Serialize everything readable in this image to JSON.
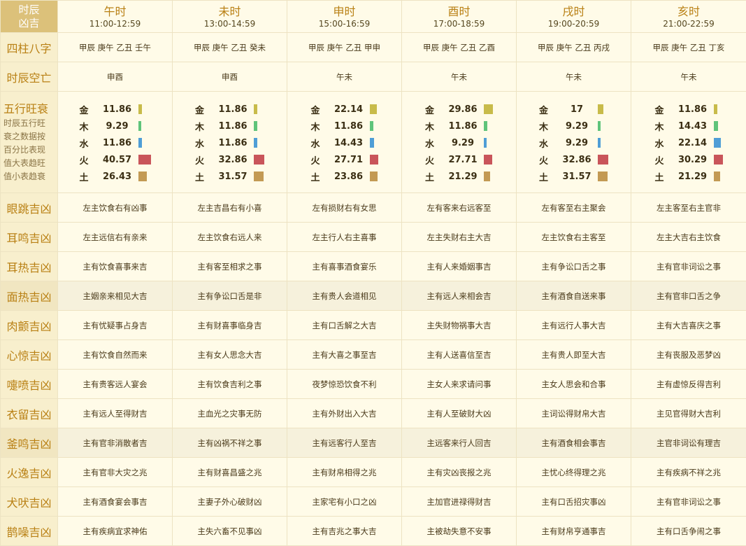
{
  "corner": {
    "line1": "时辰",
    "line2": "凶吉"
  },
  "columns": [
    {
      "name": "午时",
      "time": "11:00-12:59"
    },
    {
      "name": "未时",
      "time": "13:00-14:59"
    },
    {
      "name": "申时",
      "time": "15:00-16:59"
    },
    {
      "name": "酉时",
      "time": "17:00-18:59"
    },
    {
      "name": "戌时",
      "time": "19:00-20:59"
    },
    {
      "name": "亥时",
      "time": "21:00-22:59"
    }
  ],
  "bazi": {
    "label": "四柱八字",
    "values": [
      "甲辰 庚午 乙丑 壬午",
      "甲辰 庚午 乙丑 癸未",
      "甲辰 庚午 乙丑 甲申",
      "甲辰 庚午 乙丑 乙酉",
      "甲辰 庚午 乙丑 丙戌",
      "甲辰 庚午 乙丑 丁亥"
    ]
  },
  "kongwang": {
    "label": "时辰空亡",
    "values": [
      "申酉",
      "申酉",
      "午未",
      "午未",
      "午未",
      "午未"
    ]
  },
  "wuxing": {
    "label": "五行旺衰",
    "desc": [
      "时辰五行旺",
      "衰之数据按",
      "百分比表现",
      "值大表趋旺",
      "值小表趋衰"
    ],
    "element_colors": {
      "金": "#c8bb4a",
      "木": "#5fc47a",
      "水": "#4f9ed6",
      "火": "#c9555a",
      "土": "#c39a54"
    },
    "columns": [
      [
        {
          "el": "金",
          "value": "11.86",
          "level": 11.86
        },
        {
          "el": "木",
          "value": "9.29",
          "level": 9.29
        },
        {
          "el": "水",
          "value": "11.86",
          "level": 11.86
        },
        {
          "el": "火",
          "value": "40.57",
          "level": 40.57
        },
        {
          "el": "土",
          "value": "26.43",
          "level": 26.43
        }
      ],
      [
        {
          "el": "金",
          "value": "11.86",
          "level": 11.86
        },
        {
          "el": "木",
          "value": "11.86",
          "level": 11.86
        },
        {
          "el": "水",
          "value": "11.86",
          "level": 11.86
        },
        {
          "el": "火",
          "value": "32.86",
          "level": 32.86
        },
        {
          "el": "土",
          "value": "31.57",
          "level": 31.57
        }
      ],
      [
        {
          "el": "金",
          "value": "22.14",
          "level": 22.14
        },
        {
          "el": "木",
          "value": "11.86",
          "level": 11.86
        },
        {
          "el": "水",
          "value": "14.43",
          "level": 14.43
        },
        {
          "el": "火",
          "value": "27.71",
          "level": 27.71
        },
        {
          "el": "土",
          "value": "23.86",
          "level": 23.86
        }
      ],
      [
        {
          "el": "金",
          "value": "29.86",
          "level": 29.86
        },
        {
          "el": "木",
          "value": "11.86",
          "level": 11.86
        },
        {
          "el": "水",
          "value": "9.29",
          "level": 9.29
        },
        {
          "el": "火",
          "value": "27.71",
          "level": 27.71
        },
        {
          "el": "土",
          "value": "21.29",
          "level": 21.29
        }
      ],
      [
        {
          "el": "金",
          "value": "17",
          "level": 17
        },
        {
          "el": "木",
          "value": "9.29",
          "level": 9.29
        },
        {
          "el": "水",
          "value": "9.29",
          "level": 9.29
        },
        {
          "el": "火",
          "value": "32.86",
          "level": 32.86
        },
        {
          "el": "土",
          "value": "31.57",
          "level": 31.57
        }
      ],
      [
        {
          "el": "金",
          "value": "11.86",
          "level": 11.86
        },
        {
          "el": "木",
          "value": "14.43",
          "level": 14.43
        },
        {
          "el": "水",
          "value": "22.14",
          "level": 22.14
        },
        {
          "el": "火",
          "value": "30.29",
          "level": 30.29
        },
        {
          "el": "土",
          "value": "21.29",
          "level": 21.29
        }
      ]
    ]
  },
  "omens": [
    {
      "label": "眼跳吉凶",
      "values": [
        "左主饮食右有凶事",
        "左主吉昌右有小喜",
        "左有损财右有女思",
        "左有客来右远客至",
        "左有客至右主聚会",
        "左主客至右主官非"
      ]
    },
    {
      "label": "耳鸣吉凶",
      "values": [
        "左主远信右有亲来",
        "左主饮食右远人来",
        "左主行人右主喜事",
        "左主失财右主大吉",
        "左主饮食右主客至",
        "左主大吉右主饮食"
      ]
    },
    {
      "label": "耳热吉凶",
      "values": [
        "主有饮食喜事来吉",
        "主有客至相求之事",
        "主有喜事酒食宴乐",
        "主有人来婚姻事吉",
        "主有争讼口舌之事",
        "主有官非词讼之事"
      ]
    },
    {
      "label": "面热吉凶",
      "values": [
        "主姻亲来相见大吉",
        "主有争讼口舌是非",
        "主有贵人会道相见",
        "主有远人来相会吉",
        "主有酒食自送来事",
        "主有官非口舌之争"
      ]
    },
    {
      "label": "肉颤吉凶",
      "values": [
        "主有忧疑事占身吉",
        "主有财喜事临身吉",
        "主有口舌解之大吉",
        "主失财物祸事大吉",
        "主有远行人事大吉",
        "主有大吉喜庆之事"
      ]
    },
    {
      "label": "心惊吉凶",
      "values": [
        "主有饮食自然而来",
        "主有女人思念大吉",
        "主有大喜之事至吉",
        "主有人送喜信至吉",
        "主有贵人即至大吉",
        "主有丧服及恶梦凶"
      ]
    },
    {
      "label": "嚏喷吉凶",
      "values": [
        "主有贵客远人宴会",
        "主有饮食吉利之事",
        "夜梦惊恐饮食不利",
        "主女人来求请问事",
        "主女人思会和合事",
        "主有虚惊反得吉利"
      ]
    },
    {
      "label": "衣留吉凶",
      "values": [
        "主有远人至得财吉",
        "主血光之灾事无防",
        "主有外财出入大吉",
        "主有人至破财大凶",
        "主词讼得财帛大吉",
        "主见官得财大吉利"
      ]
    },
    {
      "label": "釜鸣吉凶",
      "values": [
        "主有官非消散者吉",
        "主有凶祸不祥之事",
        "主有远客行人至吉",
        "主远客来行人回吉",
        "主有酒食相会事吉",
        "主官非词讼有理吉"
      ]
    },
    {
      "label": "火逸吉凶",
      "values": [
        "主有官非大灾之兆",
        "主有财喜昌盛之兆",
        "主有财帛相得之兆",
        "主有灾凶丧报之兆",
        "主忧心终得理之兆",
        "主有疾病不祥之兆"
      ]
    },
    {
      "label": "犬吠吉凶",
      "values": [
        "主有酒食宴会事吉",
        "主妻子外心破财凶",
        "主家宅有小口之凶",
        "主加官进禄得财吉",
        "主有口舌招灾事凶",
        "主有官非词讼之事"
      ]
    },
    {
      "label": "鹊噪吉凶",
      "values": [
        "主有疾病宜求神佑",
        "主失六畜不见事凶",
        "主有吉兆之事大吉",
        "主被劫失意不安事",
        "主有财帛亨通事吉",
        "主有口舌争闹之事"
      ]
    }
  ]
}
